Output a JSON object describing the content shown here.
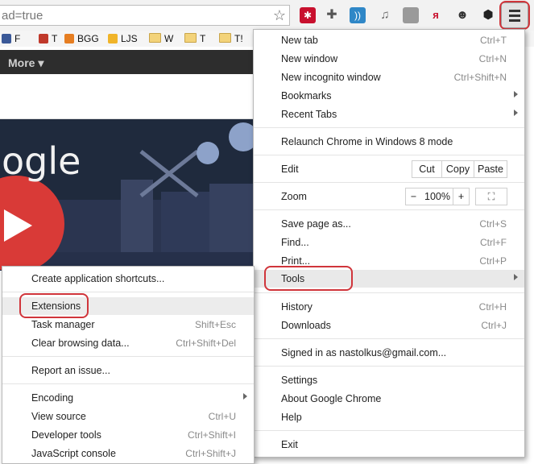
{
  "omnibox": {
    "url_text": "ad=true"
  },
  "bookmarks": [
    {
      "label": "F",
      "icon": "facebook-icon",
      "kind": "site",
      "color": "#3b5998"
    },
    {
      "label": "T",
      "icon": "site-icon",
      "kind": "site",
      "color": "#c0392b"
    },
    {
      "label": "BGG",
      "icon": "bgg-icon",
      "kind": "site",
      "color": "#e67e22"
    },
    {
      "label": "LJS",
      "icon": "ljs-icon",
      "kind": "site",
      "color": "#f0b429"
    },
    {
      "label": "W",
      "icon": "folder-icon",
      "kind": "folder"
    },
    {
      "label": "T",
      "icon": "folder-icon",
      "kind": "folder"
    },
    {
      "label": "T!",
      "icon": "folder-icon",
      "kind": "folder"
    }
  ],
  "page": {
    "more_label": "More ▾",
    "doodle_text": "ogle"
  },
  "main_menu": {
    "new_tab": {
      "label": "New tab",
      "shortcut": "Ctrl+T"
    },
    "new_window": {
      "label": "New window",
      "shortcut": "Ctrl+N"
    },
    "new_incognito": {
      "label": "New incognito window",
      "shortcut": "Ctrl+Shift+N"
    },
    "bookmarks": {
      "label": "Bookmarks"
    },
    "recent_tabs": {
      "label": "Recent Tabs"
    },
    "relaunch": {
      "label": "Relaunch Chrome in Windows 8 mode"
    },
    "edit": {
      "label": "Edit",
      "cut": "Cut",
      "copy": "Copy",
      "paste": "Paste"
    },
    "zoom": {
      "label": "Zoom",
      "minus": "−",
      "level": "100%",
      "plus": "+",
      "fullscreen": "⛶"
    },
    "save_page": {
      "label": "Save page as...",
      "shortcut": "Ctrl+S"
    },
    "find": {
      "label": "Find...",
      "shortcut": "Ctrl+F"
    },
    "print": {
      "label": "Print...",
      "shortcut": "Ctrl+P"
    },
    "tools": {
      "label": "Tools"
    },
    "history": {
      "label": "History",
      "shortcut": "Ctrl+H"
    },
    "downloads": {
      "label": "Downloads",
      "shortcut": "Ctrl+J"
    },
    "signed_in": {
      "label": "Signed in as nastolkus@gmail.com..."
    },
    "settings": {
      "label": "Settings"
    },
    "about": {
      "label": "About Google Chrome"
    },
    "help": {
      "label": "Help"
    },
    "exit": {
      "label": "Exit"
    }
  },
  "tools_menu": {
    "create_shortcuts": {
      "label": "Create application shortcuts..."
    },
    "extensions": {
      "label": "Extensions"
    },
    "task_manager": {
      "label": "Task manager",
      "shortcut": "Shift+Esc"
    },
    "clear_data": {
      "label": "Clear browsing data...",
      "shortcut": "Ctrl+Shift+Del"
    },
    "report_issue": {
      "label": "Report an issue..."
    },
    "encoding": {
      "label": "Encoding"
    },
    "view_source": {
      "label": "View source",
      "shortcut": "Ctrl+U"
    },
    "dev_tools": {
      "label": "Developer tools",
      "shortcut": "Ctrl+Shift+I"
    },
    "js_console": {
      "label": "JavaScript console",
      "shortcut": "Ctrl+Shift+J"
    }
  },
  "colors": {
    "highlight_ring": "#d0353b",
    "menu_hover": "#e9e9e9"
  }
}
